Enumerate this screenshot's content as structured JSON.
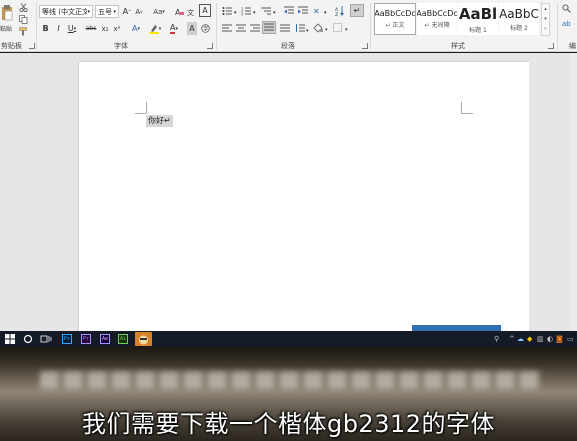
{
  "ribbon": {
    "clipboard": {
      "paste_label": "粘贴",
      "group_label": "剪贴板"
    },
    "font": {
      "font_name": "等线 (中文正文",
      "font_size": "五号",
      "case_label": "Aa",
      "bold": "B",
      "italic": "I",
      "underline": "U",
      "strike": "abc",
      "subscript": "x₂",
      "superscript": "x²",
      "text_effect": "A",
      "font_color": "A",
      "char_border": "A",
      "group_label": "字体"
    },
    "paragraph": {
      "group_label": "段落"
    },
    "styles": {
      "items": [
        {
          "preview": "AaBbCcDc",
          "name": "↵ 正文"
        },
        {
          "preview": "AaBbCcDc",
          "name": "↵ 无间隔"
        },
        {
          "preview": "AaBl",
          "name": "标题 1"
        },
        {
          "preview": "AaBbC",
          "name": "标题 2"
        }
      ],
      "group_label": "样式"
    },
    "editing": {
      "group_label": "编"
    }
  },
  "document": {
    "text": "你好↵"
  },
  "taskbar": {
    "apps": [
      "Ps",
      "Pr",
      "Ae",
      "Ai"
    ]
  },
  "video": {
    "subtitle": "我们需要下载一个楷体gb2312的字体"
  },
  "colors": {
    "accent_blue": "#2f6fb1",
    "font_color_red": "#d13438",
    "highlight_yellow": "#ffe600",
    "taskbar": "#151b26"
  }
}
